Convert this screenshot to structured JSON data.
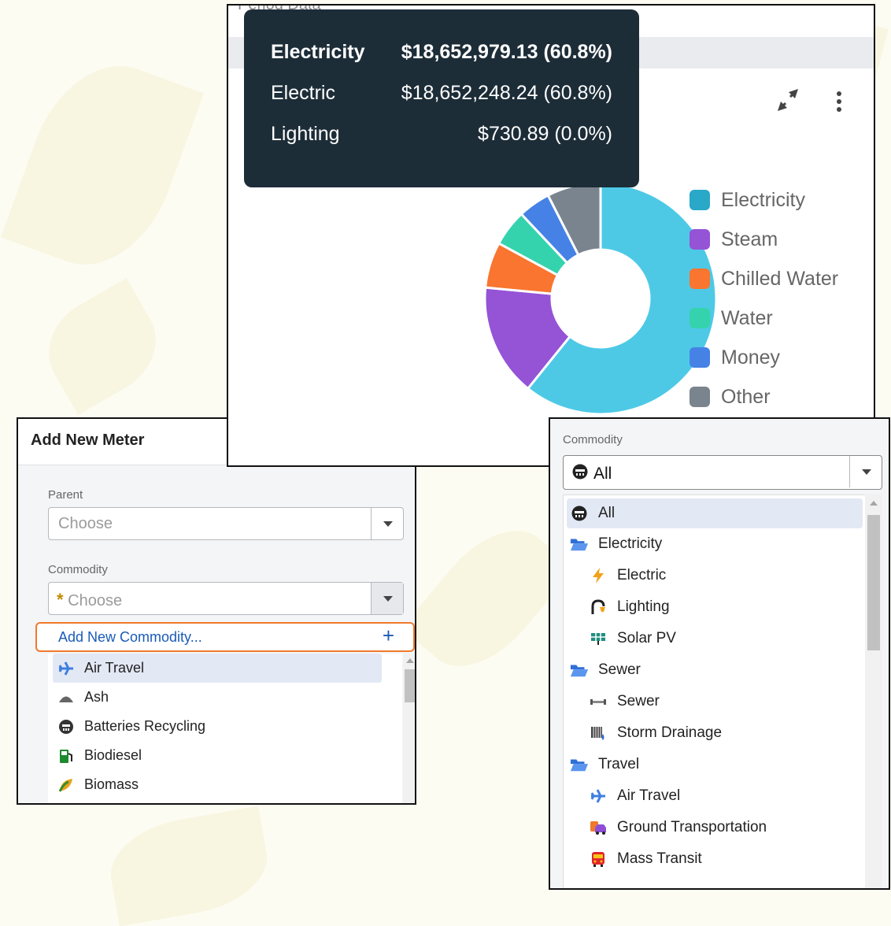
{
  "colors": {
    "electricity": "#4dc9e6",
    "steam": "#9553d6",
    "chilled_water": "#f97530",
    "water": "#35d3ad",
    "money": "#4682e6",
    "other": "#7a848e",
    "legend_electricity": "#2aa8c7",
    "accent_link": "#1a5bb8",
    "highlight_border": "#f07a2b",
    "tooltip_bg": "#1d2d38"
  },
  "chart_panel": {
    "title_fragment": "Period Data",
    "tooltip": {
      "rows": [
        {
          "name": "Electricity",
          "value": "$18,652,979.13 (60.8%)"
        },
        {
          "name": "Electric",
          "value": "$18,652,248.24 (60.8%)"
        },
        {
          "name": "Lighting",
          "value": "$730.89 (0.0%)"
        }
      ]
    },
    "icons": {
      "expand": "expand-icon",
      "more": "more-vertical-icon"
    }
  },
  "chart_data": {
    "type": "pie",
    "donut": true,
    "categories": [
      "Electricity",
      "Steam",
      "Chilled Water",
      "Water",
      "Money",
      "Other"
    ],
    "values": [
      60.8,
      15.7,
      6.4,
      5.1,
      4.5,
      7.5
    ],
    "legend": [
      "Electricity",
      "Steam",
      "Chilled Water",
      "Water",
      "Money",
      "Other"
    ],
    "legend_position": "right"
  },
  "meter_dialog": {
    "title": "Add New Meter",
    "parent_label": "Parent",
    "parent_placeholder": "Choose",
    "commodity_label": "Commodity",
    "commodity_required_mark": "*",
    "commodity_placeholder": "Choose",
    "add_commodity_label": "Add New Commodity...",
    "add_icon": "+",
    "items": [
      {
        "label": "Air Travel",
        "icon": "airplane-icon"
      },
      {
        "label": "Ash",
        "icon": "ash-pile-icon"
      },
      {
        "label": "Batteries Recycling",
        "icon": "battery-recycle-icon"
      },
      {
        "label": "Biodiesel",
        "icon": "fuel-pump-icon"
      },
      {
        "label": "Biomass",
        "icon": "leaf-icon"
      }
    ]
  },
  "commodity_filter": {
    "label": "Commodity",
    "selected_value": "All",
    "items": [
      {
        "label": "All",
        "icon": "globe-icon",
        "level": 0
      },
      {
        "label": "Electricity",
        "icon": "folder-icon",
        "level": 0
      },
      {
        "label": "Electric",
        "icon": "lightning-icon",
        "level": 1
      },
      {
        "label": "Lighting",
        "icon": "lamp-icon",
        "level": 1
      },
      {
        "label": "Solar PV",
        "icon": "solar-panel-icon",
        "level": 1
      },
      {
        "label": "Sewer",
        "icon": "folder-icon",
        "level": 0
      },
      {
        "label": "Sewer",
        "icon": "pipe-icon",
        "level": 1
      },
      {
        "label": "Storm Drainage",
        "icon": "storm-drain-icon",
        "level": 1
      },
      {
        "label": "Travel",
        "icon": "folder-icon",
        "level": 0
      },
      {
        "label": "Air Travel",
        "icon": "airplane-icon",
        "level": 1
      },
      {
        "label": "Ground Transportation",
        "icon": "car-icon",
        "level": 1
      },
      {
        "label": "Mass Transit",
        "icon": "bus-icon",
        "level": 1
      }
    ]
  }
}
